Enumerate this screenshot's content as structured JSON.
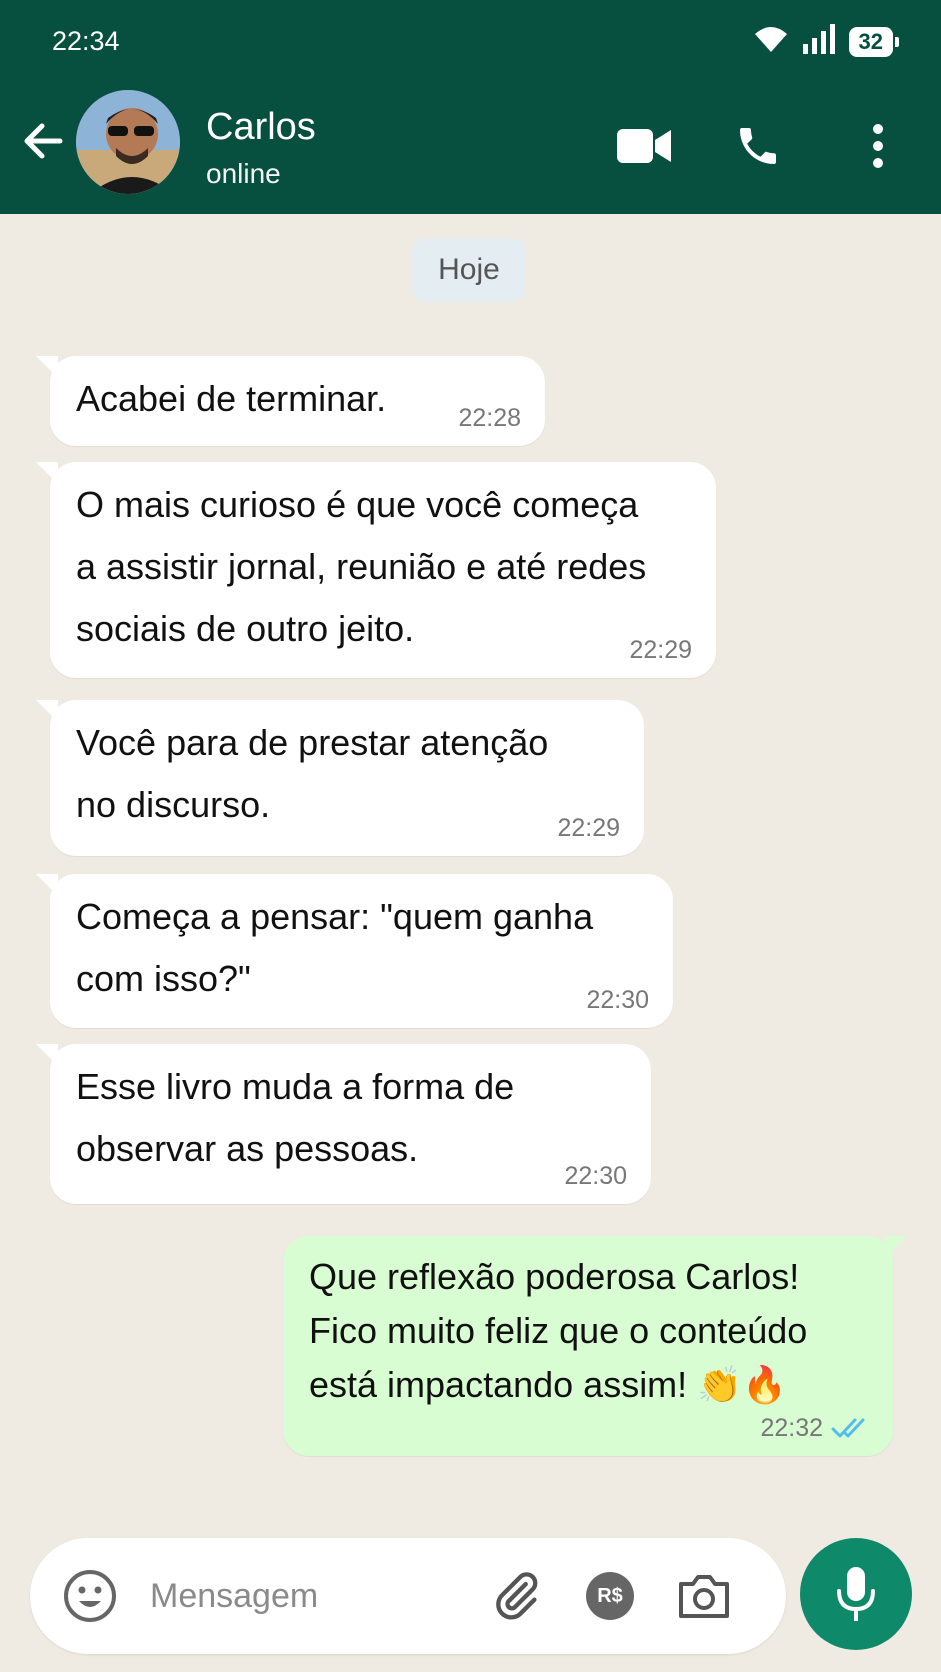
{
  "status_bar": {
    "time": "22:34",
    "battery": "32"
  },
  "header": {
    "contact_name": "Carlos",
    "contact_status": "online"
  },
  "chat": {
    "date_chip": "Hoje",
    "messages": [
      {
        "direction": "in",
        "text": "Acabei de terminar.",
        "time": "22:28"
      },
      {
        "direction": "in",
        "text": "O mais curioso é que você começa\na assistir jornal, reunião e até redes\nsociais de outro jeito.",
        "time": "22:29"
      },
      {
        "direction": "in",
        "text": "Você para de prestar atenção\nno discurso.",
        "time": "22:29"
      },
      {
        "direction": "in",
        "text": "Começa a pensar: \"quem ganha\ncom isso?\"",
        "time": "22:30"
      },
      {
        "direction": "in",
        "text": "Esse livro muda a forma de\nobservar as pessoas.",
        "time": "22:30"
      },
      {
        "direction": "out",
        "text": "Que reflexão poderosa Carlos!\nFico muito feliz que o conteúdo\nestá impactando assim! 👏🔥",
        "time": "22:32",
        "status": "read"
      }
    ]
  },
  "composer": {
    "placeholder": "Mensagem",
    "payment_label": "R$"
  },
  "colors": {
    "header": "#074F3E",
    "outgoing": "#D9FDD3",
    "incoming": "#FFFFFF",
    "accent": "#0E8A6A",
    "read_ticks": "#53BDEB"
  },
  "icons": [
    "wifi-icon",
    "signal-icon",
    "back-arrow-icon",
    "video-call-icon",
    "phone-icon",
    "more-options-icon",
    "emoji-icon",
    "attach-icon",
    "camera-icon",
    "mic-icon",
    "double-check-icon"
  ]
}
